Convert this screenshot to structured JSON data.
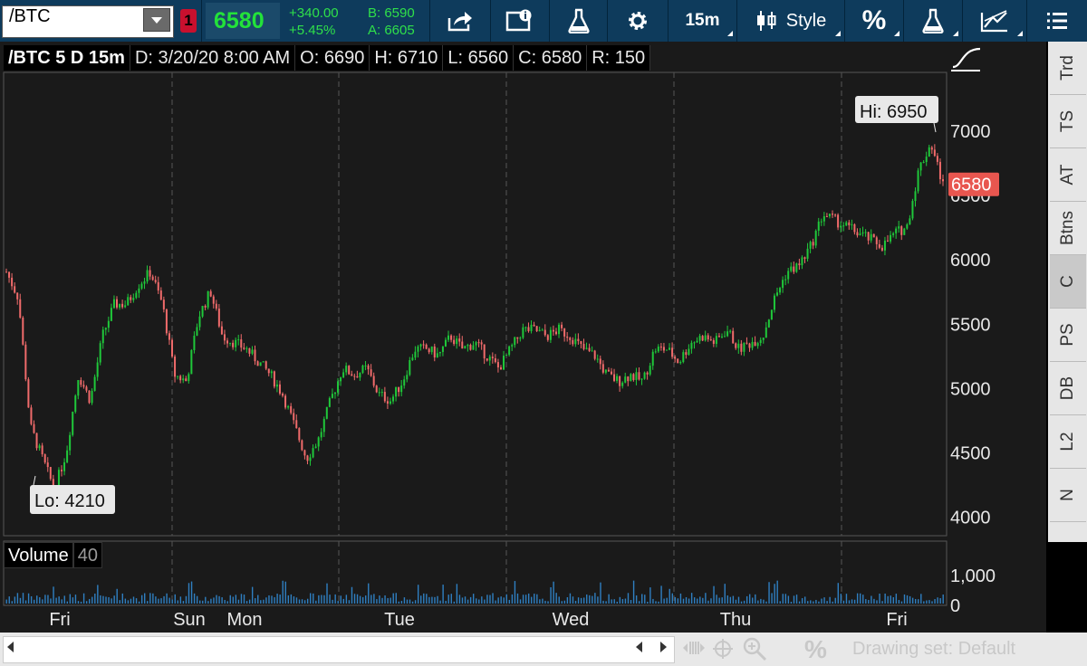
{
  "toolbar": {
    "symbol": "/BTC",
    "link_badge": "1",
    "last": "6580",
    "net_change": "+340.00",
    "pct_change": "+5.45%",
    "bid": "B: 6590",
    "ask": "A: 6605",
    "timeframe": "15m",
    "style": "Style"
  },
  "header": {
    "title": "/BTC 5 D 15m",
    "date": "D: 3/20/20 8:00 AM",
    "open": "O: 6690",
    "high": "H: 6710",
    "low": "L: 6560",
    "close": "C: 6580",
    "range": "R: 150"
  },
  "chart_data": {
    "type": "candlestick",
    "title": "/BTC 5 D 15m",
    "y_ticks": [
      4000,
      4500,
      5000,
      5500,
      6000,
      6500,
      7000
    ],
    "ylim": [
      3850,
      7450
    ],
    "x_labels": [
      "Fri",
      "Sun",
      "Mon",
      "Tue",
      "Wed",
      "Thu",
      "Fri"
    ],
    "series": [
      {
        "approx_close": [
          5900,
          5700,
          4700,
          4450,
          4210,
          4500,
          5100,
          4900,
          5400,
          5650,
          5650,
          5800,
          5900,
          5650,
          5100,
          5050,
          5550,
          5750,
          5400,
          5350,
          5300,
          5200,
          5100,
          4950,
          4700,
          4450,
          4600,
          4900,
          5150,
          5100,
          5150,
          4950,
          4900,
          5050,
          5300,
          5300,
          5250,
          5400,
          5300,
          5350,
          5250,
          5150,
          5300,
          5450,
          5450,
          5400,
          5450,
          5400,
          5300,
          5250,
          5100,
          5050,
          5100,
          5050,
          5300,
          5300,
          5200,
          5350,
          5400,
          5350,
          5450,
          5300,
          5350,
          5400,
          5700,
          5900,
          5950,
          6100,
          6350,
          6300,
          6250,
          6200,
          6150,
          6100,
          6200,
          6250,
          6700,
          6900,
          6580
        ]
      }
    ],
    "last": 6580,
    "high_marker": "Hi: 6950",
    "low_marker": "Lo: 4210",
    "volume": {
      "label": "Volume",
      "length": "40",
      "ticks": [
        "1,000",
        "0"
      ]
    }
  },
  "right_tabs": [
    "Trd",
    "TS",
    "AT",
    "Btns",
    "C",
    "PS",
    "DB",
    "L2",
    "N"
  ],
  "right_tabs_active": "C",
  "bottom": {
    "drawing_set": "Drawing set: Default"
  },
  "colors": {
    "up": "#1fc83a",
    "down": "#f06b6b",
    "toolbar": "#0e3b5c",
    "last_price_tag": "#e8564f"
  }
}
